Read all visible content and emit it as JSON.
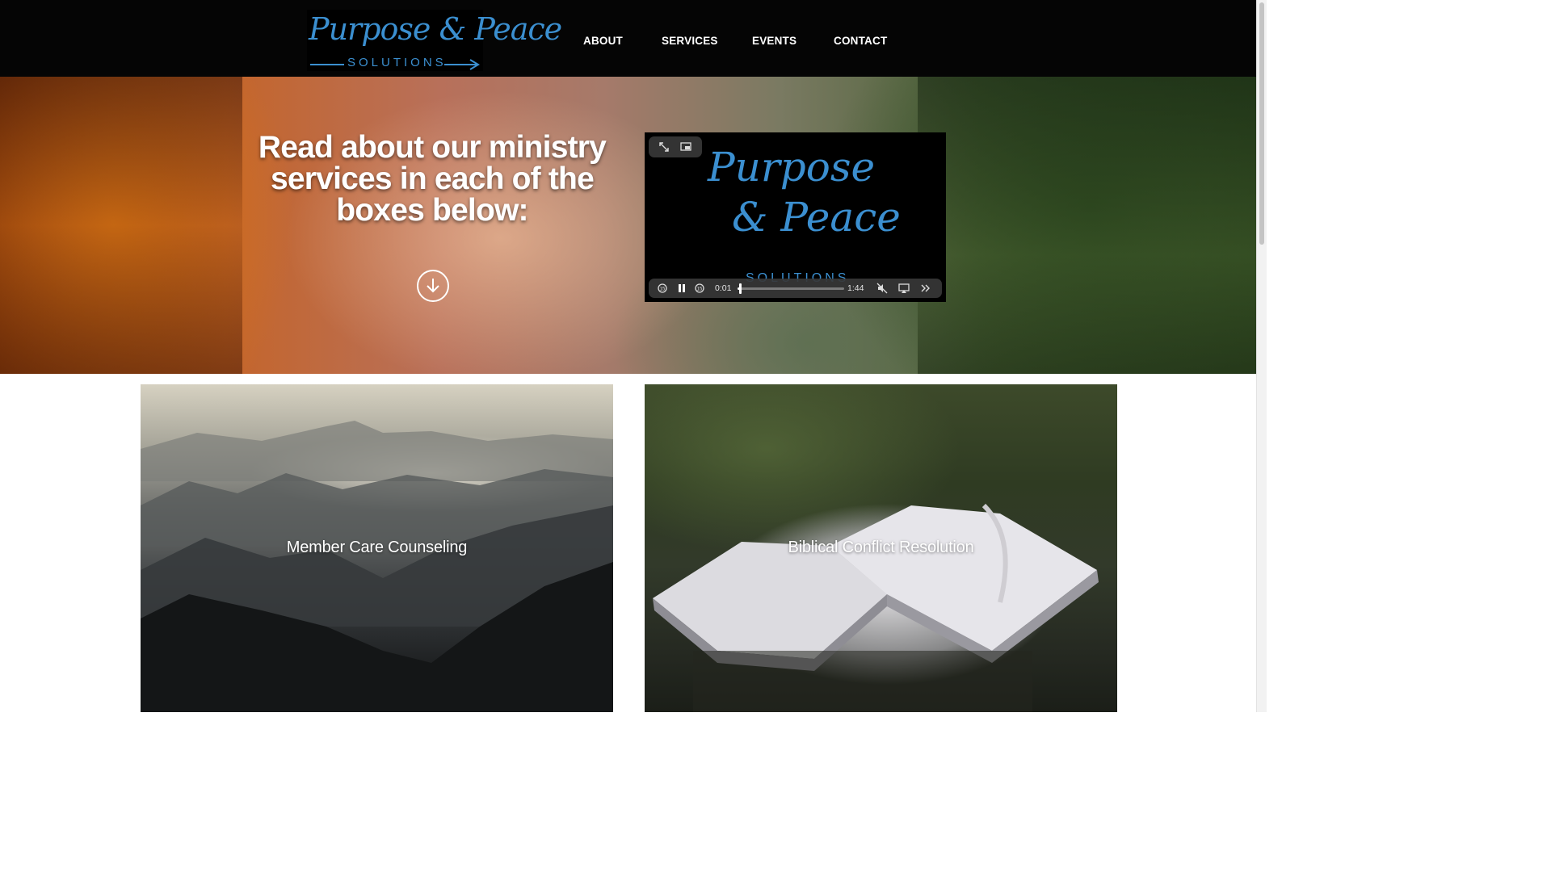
{
  "header": {
    "logo": {
      "script": "Purpose & Peace",
      "subtitle": "SOLUTIONS"
    },
    "nav": [
      "ABOUT",
      "SERVICES",
      "EVENTS",
      "CONTACT"
    ]
  },
  "hero": {
    "title": "Read about our ministry services in each of the boxes below:",
    "scroll_icon": "arrow-down-circle-icon"
  },
  "video": {
    "logo_line1": "Purpose",
    "logo_line2": "& Peace",
    "logo_sub": "SOLUTIONS",
    "current_time": "0:01",
    "duration": "1:44",
    "progress": 0.01,
    "icons": [
      "expand-icon",
      "picture-in-picture-icon",
      "skip-back-icon",
      "pause-icon",
      "skip-forward-icon",
      "mute-icon",
      "airplay-icon",
      "fast-forward-icon"
    ]
  },
  "services": [
    {
      "label": "Member Care Counseling"
    },
    {
      "label": "Biblical Conflict Resolution"
    }
  ],
  "colors": {
    "brand_blue": "#3b8fd0",
    "header_bg": "#050505"
  }
}
